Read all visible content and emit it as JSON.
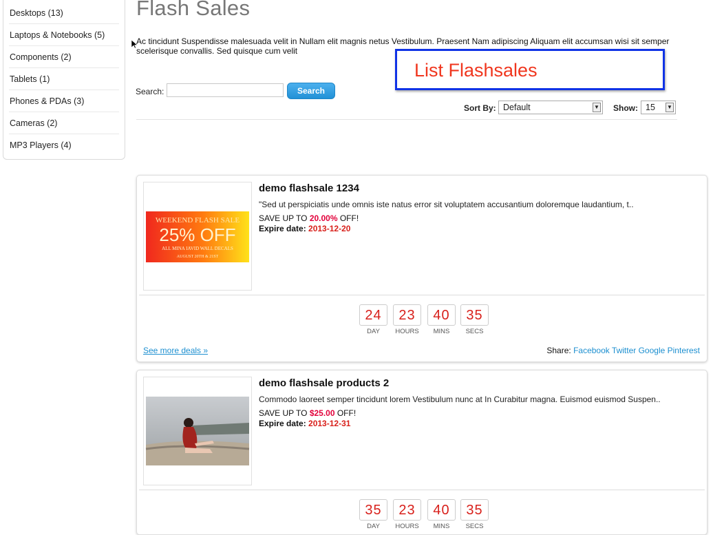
{
  "sidebar": {
    "categories": [
      {
        "label": "Desktops (13)"
      },
      {
        "label": "Laptops & Notebooks (5)"
      },
      {
        "label": "Components (2)"
      },
      {
        "label": "Tablets (1)"
      },
      {
        "label": "Phones & PDAs (3)"
      },
      {
        "label": "Cameras (2)"
      },
      {
        "label": "MP3 Players (4)"
      }
    ]
  },
  "page": {
    "title": "Flash Sales",
    "intro": "Ac tincidunt Suspendisse malesuada velit in Nullam elit magnis netus Vestibulum. Praesent Nam adipiscing Aliquam elit accumsan wisi sit semper scelerisque convallis. Sed quisque cum velit",
    "annotation": "List Flashsales"
  },
  "search": {
    "label": "Search:",
    "value": "",
    "button": "Search"
  },
  "sort": {
    "label": "Sort By:",
    "selected": "Default"
  },
  "show": {
    "label": "Show:",
    "selected": "15"
  },
  "deals": [
    {
      "name": "demo flashsale 1234",
      "description": "\"Sed ut perspiciatis unde omnis iste natus error sit voluptatem accusantium doloremque laudantium, t..",
      "save_prefix": "SAVE UP TO ",
      "save_value": "20.00%",
      "save_suffix": " OFF!",
      "expire_label": "Expire date: ",
      "expire_date": "2013-12-20",
      "image_text": {
        "line1": "WEEKEND FLASH SALE",
        "line2": "25% OFF",
        "line3": "ALL MINA IAVID WALL DECALS",
        "line4": "AUGUST 20TH & 21ST"
      },
      "countdown": [
        {
          "value": "24",
          "unit": "DAY"
        },
        {
          "value": "23",
          "unit": "HOURS"
        },
        {
          "value": "40",
          "unit": "MINS"
        },
        {
          "value": "35",
          "unit": "SECS"
        }
      ],
      "see_more": "See more deals »",
      "share_label": "Share:",
      "share_links": [
        "Facebook",
        "Twitter",
        "Google",
        "Pinterest"
      ]
    },
    {
      "name": "demo flashsale products 2",
      "description": "Commodo laoreet semper tincidunt lorem Vestibulum nunc at In Curabitur magna. Euismod euismod Suspen..",
      "save_prefix": "SAVE UP TO ",
      "save_value": "$25.00",
      "save_suffix": " OFF!",
      "expire_label": "Expire date: ",
      "expire_date": "2013-12-31",
      "countdown": [
        {
          "value": "35",
          "unit": "DAY"
        },
        {
          "value": "23",
          "unit": "HOURS"
        },
        {
          "value": "40",
          "unit": "MINS"
        },
        {
          "value": "35",
          "unit": "SECS"
        }
      ]
    }
  ],
  "colors": {
    "accent_red": "#d8201b",
    "link_blue": "#1c8fd0",
    "annotation_border": "#1033e6",
    "annotation_text": "#f0361e"
  }
}
